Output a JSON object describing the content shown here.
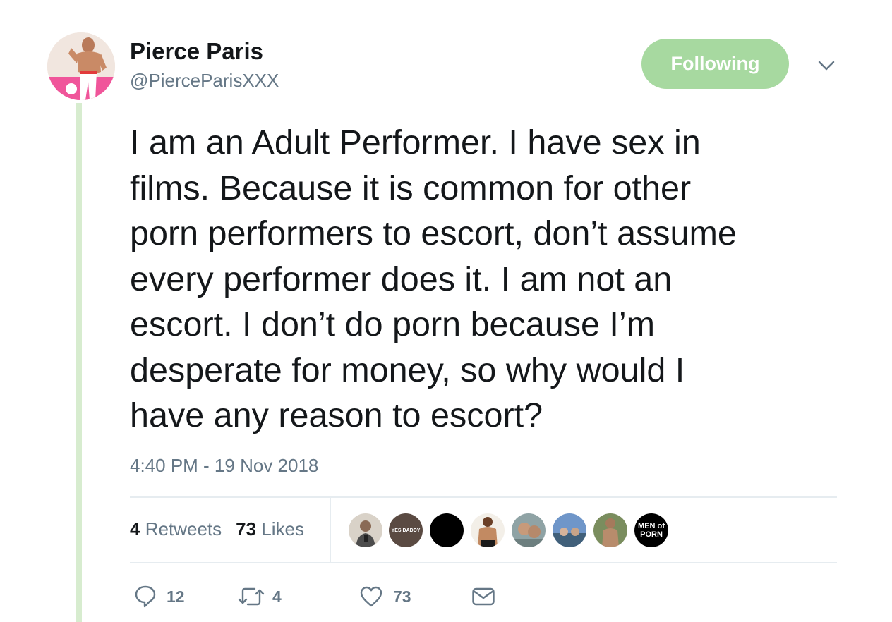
{
  "user": {
    "display_name": "Pierce Paris",
    "handle": "@PierceParisXXX",
    "avatar_icon": "profile-photo",
    "thread_line_color": "#d7eccf"
  },
  "follow_button": {
    "label": "Following",
    "color": "#a7d9a0",
    "caret_icon": "chevron-down-icon"
  },
  "tweet": {
    "text": "I am an Adult Performer. I have sex in\nfilms. Because it is common for other\nporn performers to escort, don’t assume\nevery performer does it. I am not an\nescort. I don’t do porn because I’m\ndesperate for money, so why would I\nhave any reason to escort?",
    "timestamp": "4:40 PM - 19 Nov 2018"
  },
  "stats": {
    "retweets_count": "4",
    "retweets_label": "Retweets",
    "likes_count": "73",
    "likes_label": "Likes"
  },
  "likers": [
    {
      "name": "liker-avatar-1",
      "text": "",
      "color": "#8a7a6c"
    },
    {
      "name": "liker-avatar-2",
      "text": "YES DADDY",
      "color": "#5a4a42"
    },
    {
      "name": "liker-avatar-3",
      "text": "",
      "color": "#000000"
    },
    {
      "name": "liker-avatar-4",
      "text": "",
      "color": "#c9a27e"
    },
    {
      "name": "liker-avatar-5",
      "text": "",
      "color": "#8fa3a5"
    },
    {
      "name": "liker-avatar-6",
      "text": "",
      "color": "#6f96c9"
    },
    {
      "name": "liker-avatar-7",
      "text": "",
      "color": "#7a8d5e"
    },
    {
      "name": "liker-avatar-8",
      "text": "MEN of PORN",
      "color": "#000000"
    }
  ],
  "actions": {
    "reply": {
      "icon": "reply-icon",
      "count": "12"
    },
    "retweet": {
      "icon": "retweet-icon",
      "count": "4"
    },
    "like": {
      "icon": "heart-icon",
      "count": "73"
    },
    "message": {
      "icon": "envelope-icon"
    }
  },
  "colors": {
    "text": "#14171a",
    "secondary": "#657786",
    "divider": "#e6ecf0"
  }
}
